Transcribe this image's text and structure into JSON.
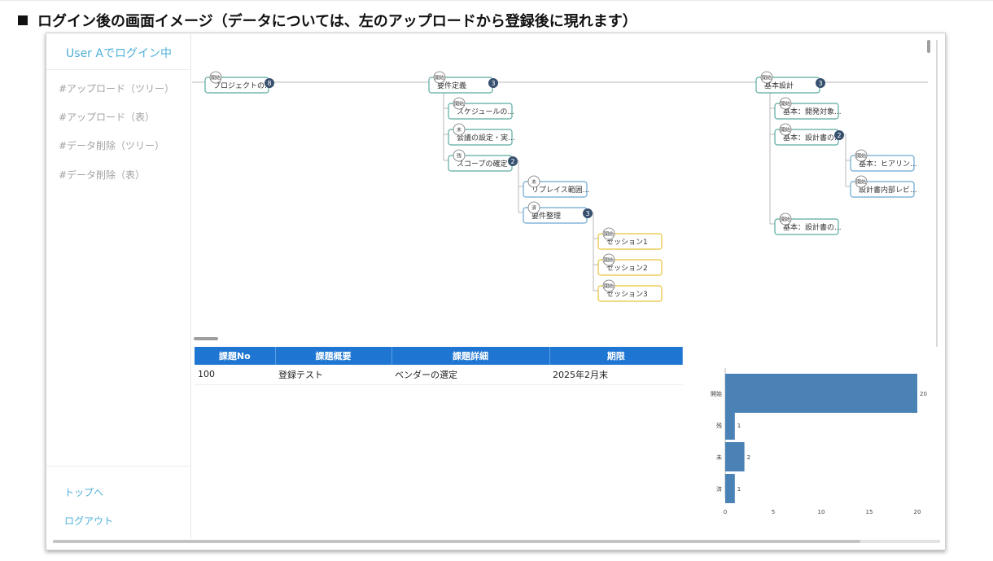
{
  "page": {
    "title": "ログイン後の画面イメージ（データについては、左のアップロードから登録後に現れます）"
  },
  "sidebar": {
    "user_label": "User Aでログイン中",
    "items": [
      {
        "label": "#アップロード（ツリー）"
      },
      {
        "label": "#アップロード（表）"
      },
      {
        "label": "#データ削除（ツリー）"
      },
      {
        "label": "#データ削除（表）"
      }
    ],
    "links": [
      {
        "label": "トップへ"
      },
      {
        "label": "ログアウト"
      }
    ]
  },
  "tree": {
    "nodes": [
      {
        "id": "n0",
        "tag": "開始",
        "label": "プロジェクトの...",
        "count": "8",
        "color": "#5aaaa0"
      },
      {
        "id": "n1",
        "tag": "開始",
        "label": "要件定義",
        "count": "3",
        "color": "#5aaaa0"
      },
      {
        "id": "n2",
        "tag": "開始",
        "label": "スケジュールの...",
        "color": "#5aaaa0"
      },
      {
        "id": "n3",
        "tag": "未",
        "label": "会議の設定・実...",
        "color": "#5aaaa0"
      },
      {
        "id": "n4",
        "tag": "残",
        "label": "スコープの確定",
        "count": "2",
        "color": "#5aaaa0"
      },
      {
        "id": "n5",
        "tag": "未",
        "label": "リプレイス範囲...",
        "color": "#6aa6d0"
      },
      {
        "id": "n6",
        "tag": "済",
        "label": "要件整理",
        "count": "3",
        "color": "#6aa6d0"
      },
      {
        "id": "n7",
        "tag": "開始",
        "label": "セッション1",
        "color": "#e8c238"
      },
      {
        "id": "n8",
        "tag": "開始",
        "label": "セッション2",
        "color": "#e8c238"
      },
      {
        "id": "n9",
        "tag": "開始",
        "label": "セッション3",
        "color": "#e8c238"
      },
      {
        "id": "n10",
        "tag": "開始",
        "label": "基本設計",
        "count": "3",
        "color": "#5aaaa0"
      },
      {
        "id": "n11",
        "tag": "開始",
        "label": "基本：開発対象...",
        "color": "#5aaaa0"
      },
      {
        "id": "n12",
        "tag": "開始",
        "label": "基本：設計書の...",
        "count": "2",
        "color": "#5aaaa0"
      },
      {
        "id": "n13",
        "tag": "開始",
        "label": "基本：ヒアリン...",
        "color": "#6aa6d0"
      },
      {
        "id": "n14",
        "tag": "開始",
        "label": "設計書内部レビ...",
        "color": "#6aa6d0"
      },
      {
        "id": "n15",
        "tag": "開始",
        "label": "基本：設計書の...",
        "color": "#5aaaa0"
      }
    ]
  },
  "table": {
    "headers": [
      "課題No",
      "課題概要",
      "課題詳細",
      "期限"
    ],
    "rows": [
      {
        "no": "100",
        "summary": "登録テスト",
        "detail": "ベンダーの選定",
        "due": "2025年2月末"
      }
    ]
  },
  "chart_data": {
    "type": "bar",
    "orientation": "horizontal",
    "categories": [
      "開始",
      "残",
      "未",
      "済"
    ],
    "values": [
      20,
      1,
      2,
      1
    ],
    "xlim": [
      0,
      20
    ],
    "xticks": [
      0,
      5,
      10,
      15,
      20
    ],
    "color": "#4a82b6",
    "title": "",
    "xlabel": "",
    "ylabel": ""
  },
  "colors": {
    "accent": "#4fb0d8",
    "table_header": "#1e76d2",
    "count_badge": "#37506e"
  }
}
